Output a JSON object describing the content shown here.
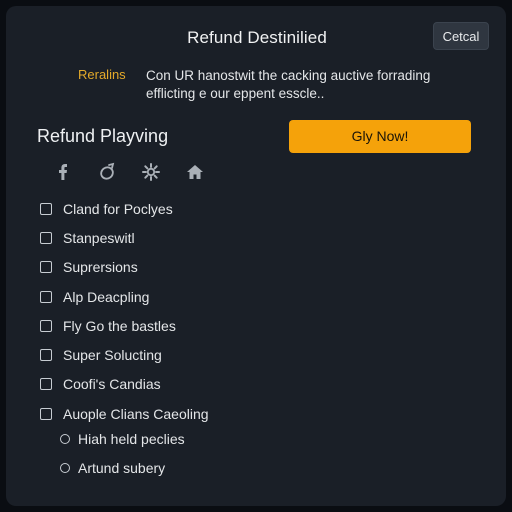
{
  "dialog": {
    "title": "Refund Destinilied",
    "cancel_label": "Cetcal"
  },
  "info": {
    "label": "Reralins",
    "text": "Con UR hanostwit the cacking auctive forrading efflicting e our eppent esscle.."
  },
  "section": {
    "title": "Refund Playving",
    "primary_button_label": "Gly Now!"
  },
  "icons": [
    {
      "name": "facebook-icon"
    },
    {
      "name": "link-icon"
    },
    {
      "name": "settings-icon"
    },
    {
      "name": "home-icon"
    }
  ],
  "checklist": [
    {
      "label": "Cland for Poclyes",
      "checked": false
    },
    {
      "label": "Stanpeswitl",
      "checked": false
    },
    {
      "label": "Suprersions",
      "checked": false
    },
    {
      "label": "Alp Deacpling",
      "checked": false
    },
    {
      "label": "Fly Go the bastles",
      "checked": false
    },
    {
      "label": "Super Solucting",
      "checked": false
    },
    {
      "label": "Coofi's Candias",
      "checked": false
    },
    {
      "label": "Auople Clians Caeoling",
      "checked": false
    }
  ],
  "sub_options": [
    {
      "label": "Hiah held peclies",
      "selected": false
    },
    {
      "label": "Artund subery",
      "selected": false
    }
  ],
  "colors": {
    "background": "#0a0d12",
    "panel": "#1a1f27",
    "accent": "#f5a20a",
    "label_accent": "#e3a92a"
  }
}
